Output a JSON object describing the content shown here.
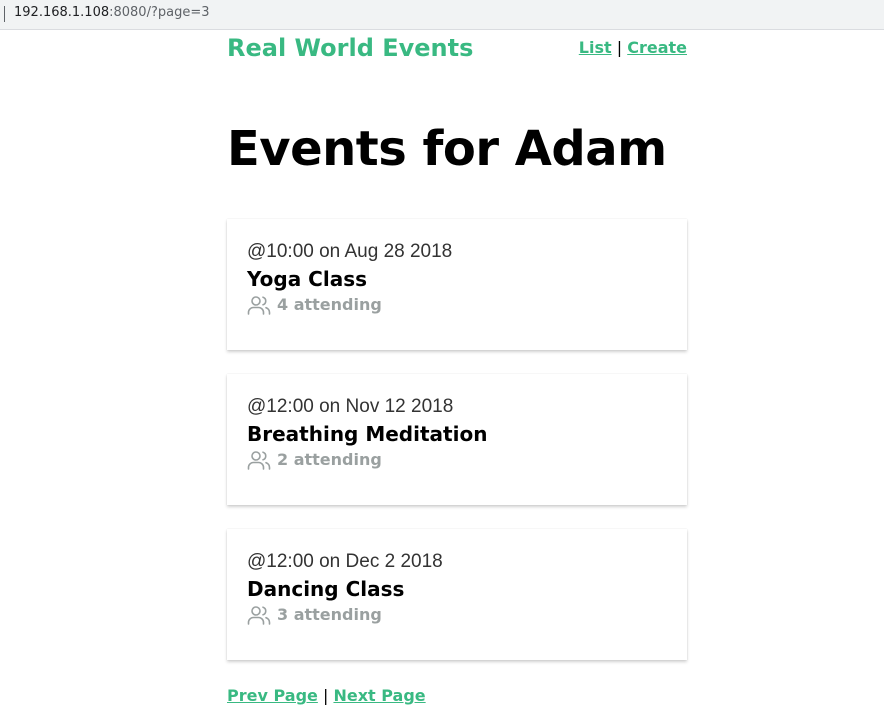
{
  "browser": {
    "url_host": "192.168.1.108",
    "url_rest": ":8080/?page=3"
  },
  "nav": {
    "brand": "Real World Events",
    "list_link": "List",
    "separator": "|",
    "create_link": "Create"
  },
  "page": {
    "title": "Events for Adam"
  },
  "events": [
    {
      "when": "@10:00 on Aug 28 2018",
      "title": "Yoga Class",
      "attending": "4 attending"
    },
    {
      "when": "@12:00 on Nov 12 2018",
      "title": "Breathing Meditation",
      "attending": "2 attending"
    },
    {
      "when": "@12:00 on Dec 2 2018",
      "title": "Dancing Class",
      "attending": "3 attending"
    }
  ],
  "pager": {
    "prev": "Prev Page",
    "separator": "|",
    "next": "Next Page"
  },
  "colors": {
    "accent": "#39b982",
    "muted": "#9aa0a0"
  },
  "icons": {
    "attending": "users-icon"
  }
}
